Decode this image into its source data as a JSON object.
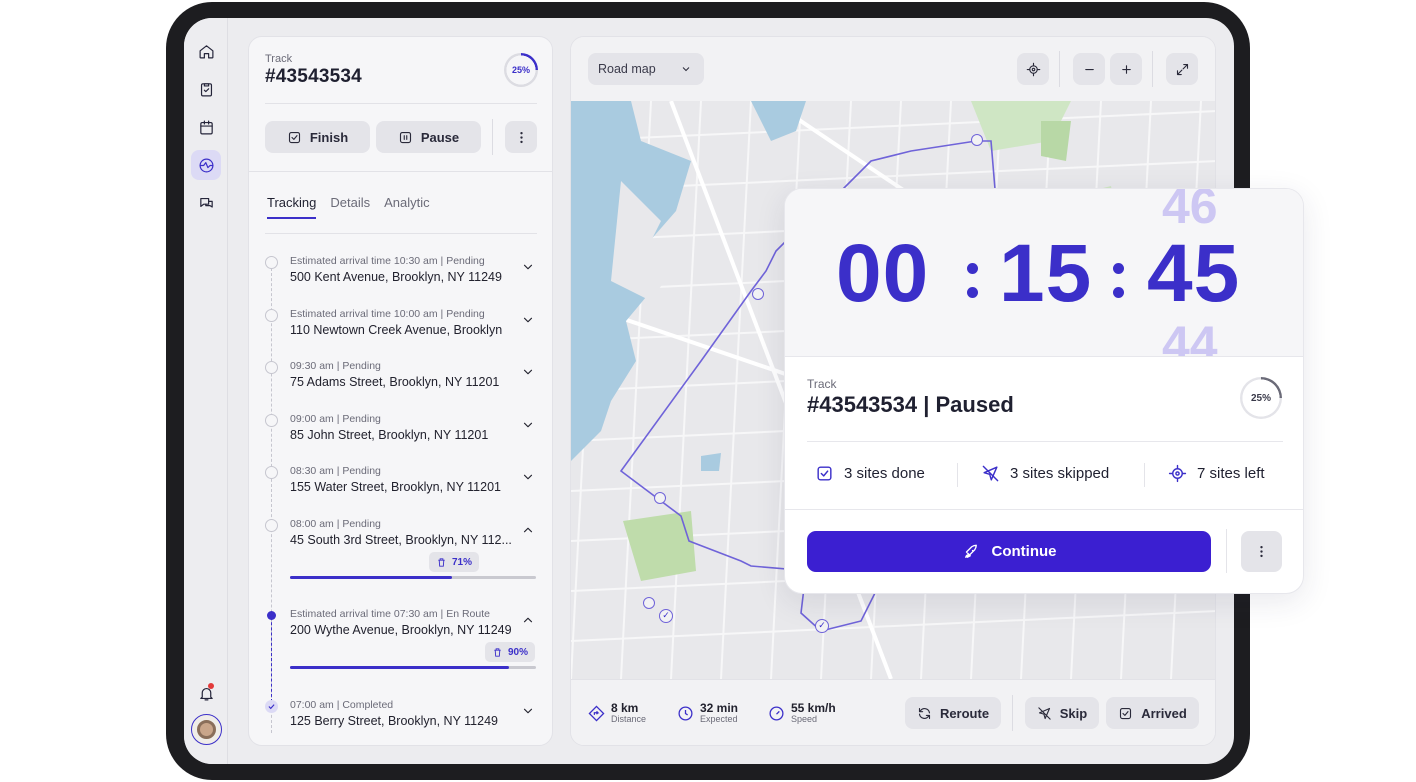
{
  "colors": {
    "accent": "#3b2fc9",
    "button": "#3b1fd1",
    "device": "#1d1d20"
  },
  "rail": {
    "items": [
      {
        "icon": "home-icon"
      },
      {
        "icon": "clipboard-check-icon"
      },
      {
        "icon": "calendar-icon"
      },
      {
        "icon": "globe-route-icon",
        "active": true
      },
      {
        "icon": "chat-icon"
      }
    ],
    "bell": "bell-icon",
    "avatar": "avatar"
  },
  "panel": {
    "label": "Track",
    "id": "#43543534",
    "progress": "25%",
    "finish": "Finish",
    "pause": "Pause",
    "tabs": [
      {
        "label": "Tracking",
        "active": true
      },
      {
        "label": "Details"
      },
      {
        "label": "Analytic"
      }
    ],
    "stops": [
      {
        "meta": "Estimated arrival time 10:30 am | Pending",
        "addr": "500 Kent Avenue, Brooklyn, NY 11249",
        "state": "pending"
      },
      {
        "meta": "Estimated arrival time 10:00 am | Pending",
        "addr": "110 Newtown Creek Avenue, Brooklyn",
        "state": "pending"
      },
      {
        "meta": "09:30 am | Pending",
        "addr": "75 Adams Street, Brooklyn, NY 11201",
        "state": "pending"
      },
      {
        "meta": "09:00 am | Pending",
        "addr": "85 John Street, Brooklyn, NY 11201",
        "state": "pending"
      },
      {
        "meta": "08:30 am | Pending",
        "addr": "155 Water Street, Brooklyn, NY 11201",
        "state": "pending"
      },
      {
        "meta": "08:00 am | Pending",
        "addr": "45 South 3rd Street, Brooklyn, NY 112...",
        "state": "pending",
        "progress": "71%",
        "progress_value": 0.66
      },
      {
        "meta": "Estimated arrival time 07:30 am | En Route",
        "addr": "200 Wythe Avenue, Brooklyn, NY 11249",
        "state": "enroute",
        "progress": "90%",
        "progress_value": 0.89
      },
      {
        "meta": "07:00 am | Completed",
        "addr": "125 Berry Street, Brooklyn, NY 11249",
        "state": "completed"
      }
    ]
  },
  "map": {
    "type": "Road map",
    "stats": [
      {
        "value": "8 km",
        "label": "Distance",
        "icon": "route-icon"
      },
      {
        "value": "32 min",
        "label": "Expected",
        "icon": "clock-icon"
      },
      {
        "value": "55 km/h",
        "label": "Speed",
        "icon": "gauge-icon"
      }
    ],
    "reroute": "Reroute",
    "skip": "Skip",
    "arrived": "Arrived"
  },
  "timer": {
    "hours": "00",
    "minutes": "15",
    "seconds": "45",
    "next_seconds": "46",
    "prev_seconds": "44",
    "label": "Track",
    "title": "#43543534 | Paused",
    "progress": "25%",
    "done": "3 sites done",
    "skipped": "3 sites skipped",
    "left": "7 sites left",
    "continue": "Continue"
  }
}
